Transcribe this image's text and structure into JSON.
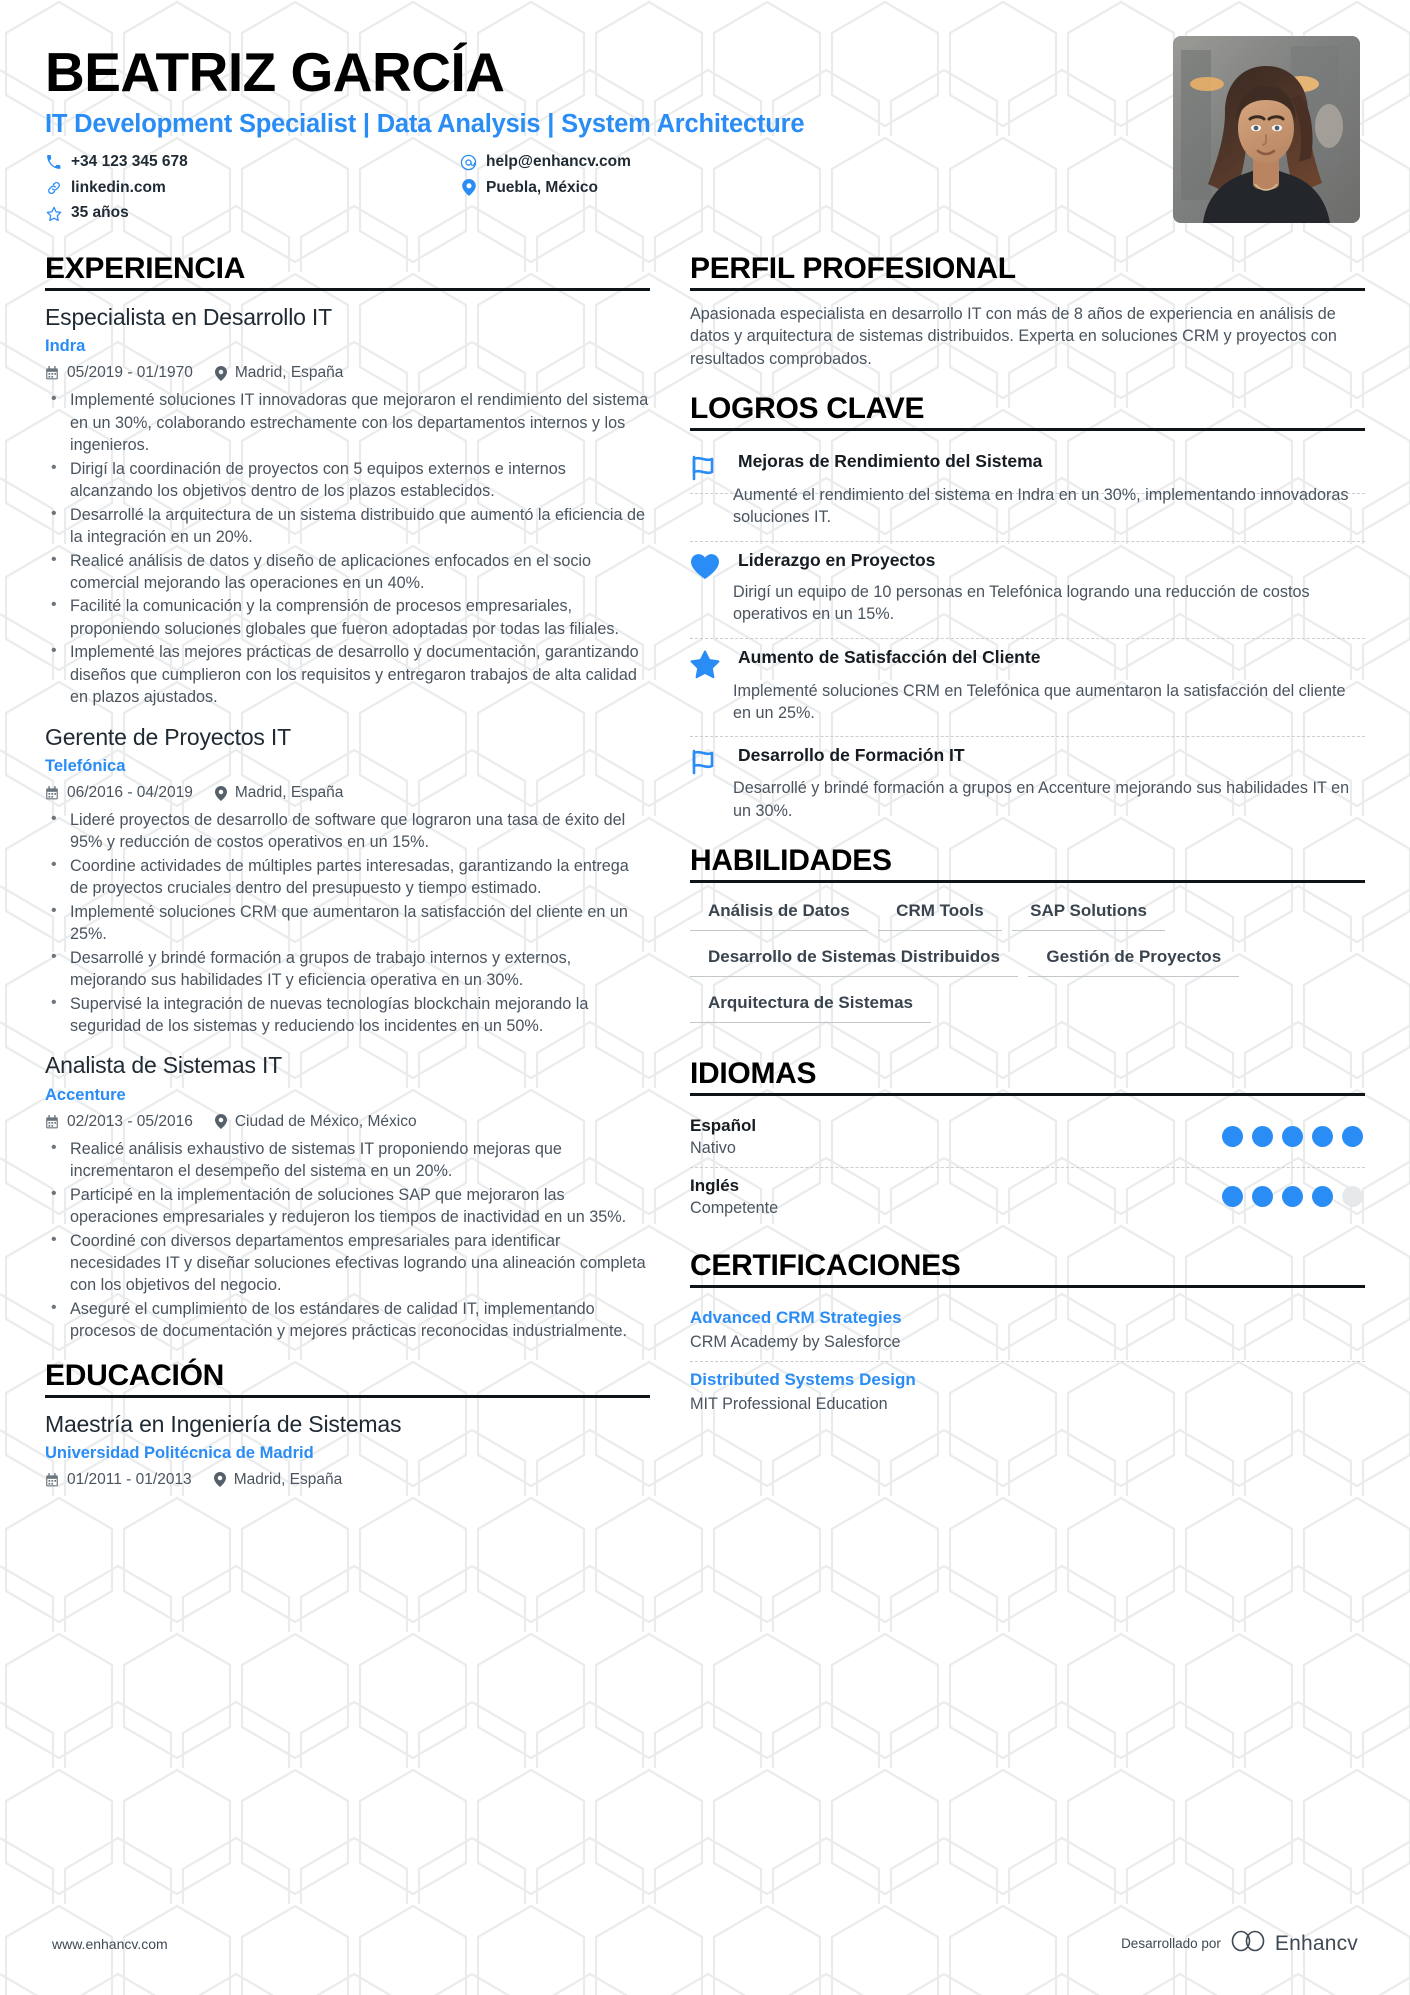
{
  "header": {
    "name": "BEATRIZ GARCÍA",
    "headline": "IT Development Specialist | Data Analysis | System Architecture",
    "contacts": [
      {
        "icon": "phone-icon",
        "text": "+34 123 345 678"
      },
      {
        "icon": "email-icon",
        "text": "help@enhancv.com"
      },
      {
        "icon": "link-icon",
        "text": "linkedin.com"
      },
      {
        "icon": "location-icon",
        "text": "Puebla, México"
      },
      {
        "icon": "star-icon",
        "text": "35 años"
      }
    ],
    "photo_alt": "portrait-photo"
  },
  "experience": {
    "title": "EXPERIENCIA",
    "jobs": [
      {
        "title": "Especialista en Desarrollo IT",
        "company": "Indra",
        "dates": "05/2019 - 01/1970",
        "location": "Madrid, España",
        "bullets": [
          "Implementé soluciones IT innovadoras que mejoraron el rendimiento del sistema en un 30%, colaborando estrechamente con los departamentos internos y los ingenieros.",
          "Dirigí la coordinación de proyectos con 5 equipos externos e internos alcanzando los objetivos dentro de los plazos establecidos.",
          "Desarrollé la arquitectura de un sistema distribuido que aumentó la eficiencia de la integración en un 20%.",
          "Realicé análisis de datos y diseño de aplicaciones enfocados en el socio comercial mejorando las operaciones en un 40%.",
          "Facilité la comunicación y la comprensión de procesos empresariales, proponiendo soluciones globales que fueron adoptadas por todas las filiales.",
          "Implementé las mejores prácticas de desarrollo y documentación, garantizando diseños que cumplieron con los requisitos y entregaron trabajos de alta calidad en plazos ajustados."
        ]
      },
      {
        "title": "Gerente de Proyectos IT",
        "company": "Telefónica",
        "dates": "06/2016 - 04/2019",
        "location": "Madrid, España",
        "bullets": [
          "Lideré proyectos de desarrollo de software que lograron una tasa de éxito del 95% y reducción de costos operativos en un 15%.",
          "Coordine actividades de múltiples partes interesadas, garantizando la entrega de proyectos cruciales dentro del presupuesto y tiempo estimado.",
          "Implementé soluciones CRM que aumentaron la satisfacción del cliente en un 25%.",
          "Desarrollé y brindé formación a grupos de trabajo internos y externos, mejorando sus habilidades IT y eficiencia operativa en un 30%.",
          "Supervisé la integración de nuevas tecnologías blockchain mejorando la seguridad de los sistemas y reduciendo los incidentes en un 50%."
        ]
      },
      {
        "title": "Analista de Sistemas IT",
        "company": "Accenture",
        "dates": "02/2013 - 05/2016",
        "location": "Ciudad de México, México",
        "bullets": [
          "Realicé análisis exhaustivo de sistemas IT proponiendo mejoras que incrementaron el desempeño del sistema en un 20%.",
          "Participé en la implementación de soluciones SAP que mejoraron las operaciones empresariales y redujeron los tiempos de inactividad en un 35%.",
          "Coordiné con diversos departamentos empresariales para identificar necesidades IT y diseñar soluciones efectivas logrando una alineación completa con los objetivos del negocio.",
          "Aseguré el cumplimiento de los estándares de calidad IT, implementando procesos de documentación y mejores prácticas reconocidas industrialmente."
        ]
      }
    ]
  },
  "education": {
    "title": "EDUCACIÓN",
    "items": [
      {
        "degree": "Maestría en Ingeniería de Sistemas",
        "school": "Universidad Politécnica de Madrid",
        "dates": "01/2011 - 01/2013",
        "location": "Madrid, España"
      }
    ]
  },
  "profile": {
    "title": "PERFIL PROFESIONAL",
    "text": "Apasionada especialista en desarrollo IT con más de 8 años de experiencia en análisis de datos y arquitectura de sistemas distribuidos. Experta en soluciones CRM y proyectos con resultados comprobados."
  },
  "achievements": {
    "title": "LOGROS CLAVE",
    "items": [
      {
        "icon": "flag-icon",
        "title": "Mejoras de Rendimiento del Sistema",
        "desc": "Aumenté el rendimiento del sistema en Indra en un 30%, implementando innovadoras soluciones IT."
      },
      {
        "icon": "heart-icon",
        "title": "Liderazgo en Proyectos",
        "desc": "Dirigí un equipo de 10 personas en Telefónica logrando una reducción de costos operativos en un 15%."
      },
      {
        "icon": "star-icon",
        "title": "Aumento de Satisfacción del Cliente",
        "desc": "Implementé soluciones CRM en Telefónica que aumentaron la satisfacción del cliente en un 25%."
      },
      {
        "icon": "flag-icon",
        "title": "Desarrollo de Formación IT",
        "desc": "Desarrollé y brindé formación a grupos en Accenture mejorando sus habilidades IT en un 30%."
      }
    ]
  },
  "skills": {
    "title": "HABILIDADES",
    "items": [
      "Análisis de Datos",
      "CRM Tools",
      "SAP Solutions",
      "Desarrollo de Sistemas Distribuidos",
      "Gestión de Proyectos",
      "Arquitectura de Sistemas"
    ]
  },
  "languages": {
    "title": "IDIOMAS",
    "items": [
      {
        "name": "Español",
        "level": "Nativo",
        "dots_filled": 5,
        "dots_total": 5
      },
      {
        "name": "Inglés",
        "level": "Competente",
        "dots_filled": 4,
        "dots_total": 5
      }
    ]
  },
  "certifications": {
    "title": "CERTIFICACIONES",
    "items": [
      {
        "name": "Advanced CRM Strategies",
        "issuer": "CRM Academy by Salesforce"
      },
      {
        "name": "Distributed Systems Design",
        "issuer": "MIT Professional Education"
      }
    ]
  },
  "footer": {
    "url": "www.enhancv.com",
    "powered_by": "Desarrollado por",
    "brand": "Enhancv"
  },
  "colors": {
    "accent": "#2a8cf5",
    "text": "#4a545e",
    "heading": "#000000",
    "dot_empty": "#e6e8ea"
  }
}
